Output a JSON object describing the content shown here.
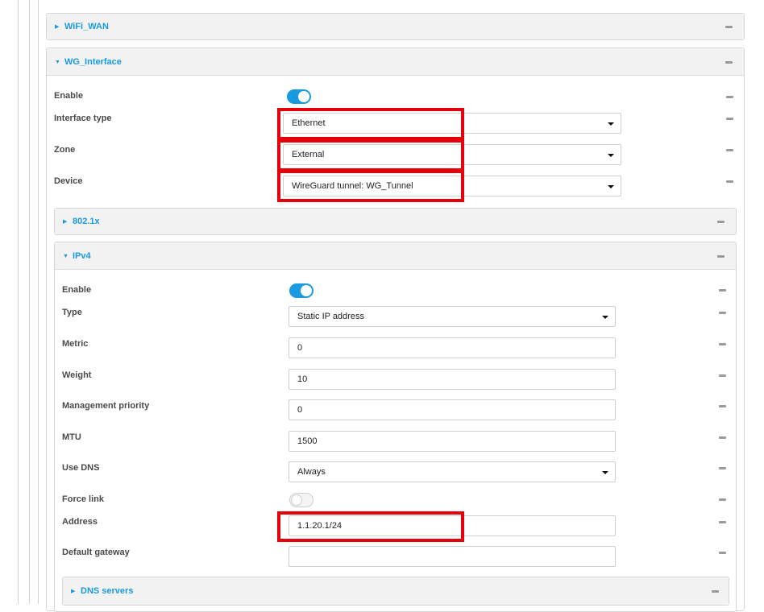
{
  "panels": {
    "wifi_wan": {
      "title": "WiFi_WAN",
      "expanded": false
    },
    "wg_interface": {
      "title": "WG_Interface",
      "expanded": true
    }
  },
  "wg_interface": {
    "enable": {
      "label": "Enable",
      "on": true
    },
    "interface_type": {
      "label": "Interface type",
      "value": "Ethernet"
    },
    "zone": {
      "label": "Zone",
      "value": "External"
    },
    "device": {
      "label": "Device",
      "value": "WireGuard tunnel: WG_Tunnel"
    }
  },
  "sub_panels": {
    "dot1x": {
      "title": "802.1x",
      "expanded": false
    },
    "ipv4": {
      "title": "IPv4",
      "expanded": true
    },
    "dns_servers": {
      "title": "DNS servers",
      "expanded": false
    }
  },
  "ipv4": {
    "enable": {
      "label": "Enable",
      "on": true
    },
    "type": {
      "label": "Type",
      "value": "Static IP address"
    },
    "metric": {
      "label": "Metric",
      "value": "0"
    },
    "weight": {
      "label": "Weight",
      "value": "10"
    },
    "management_priority": {
      "label": "Management priority",
      "value": "0"
    },
    "mtu": {
      "label": "MTU",
      "value": "1500"
    },
    "use_dns": {
      "label": "Use DNS",
      "value": "Always"
    },
    "force_link": {
      "label": "Force link",
      "on": false
    },
    "address": {
      "label": "Address",
      "value": "1.1.20.1/24"
    },
    "default_gateway": {
      "label": "Default gateway",
      "value": ""
    }
  },
  "icons": {
    "expand": "triangle-right-icon",
    "collapse": "triangle-down-icon",
    "dash": "minus-icon"
  },
  "colors": {
    "accent": "#1a9ae0",
    "highlight": "#e5000a"
  }
}
